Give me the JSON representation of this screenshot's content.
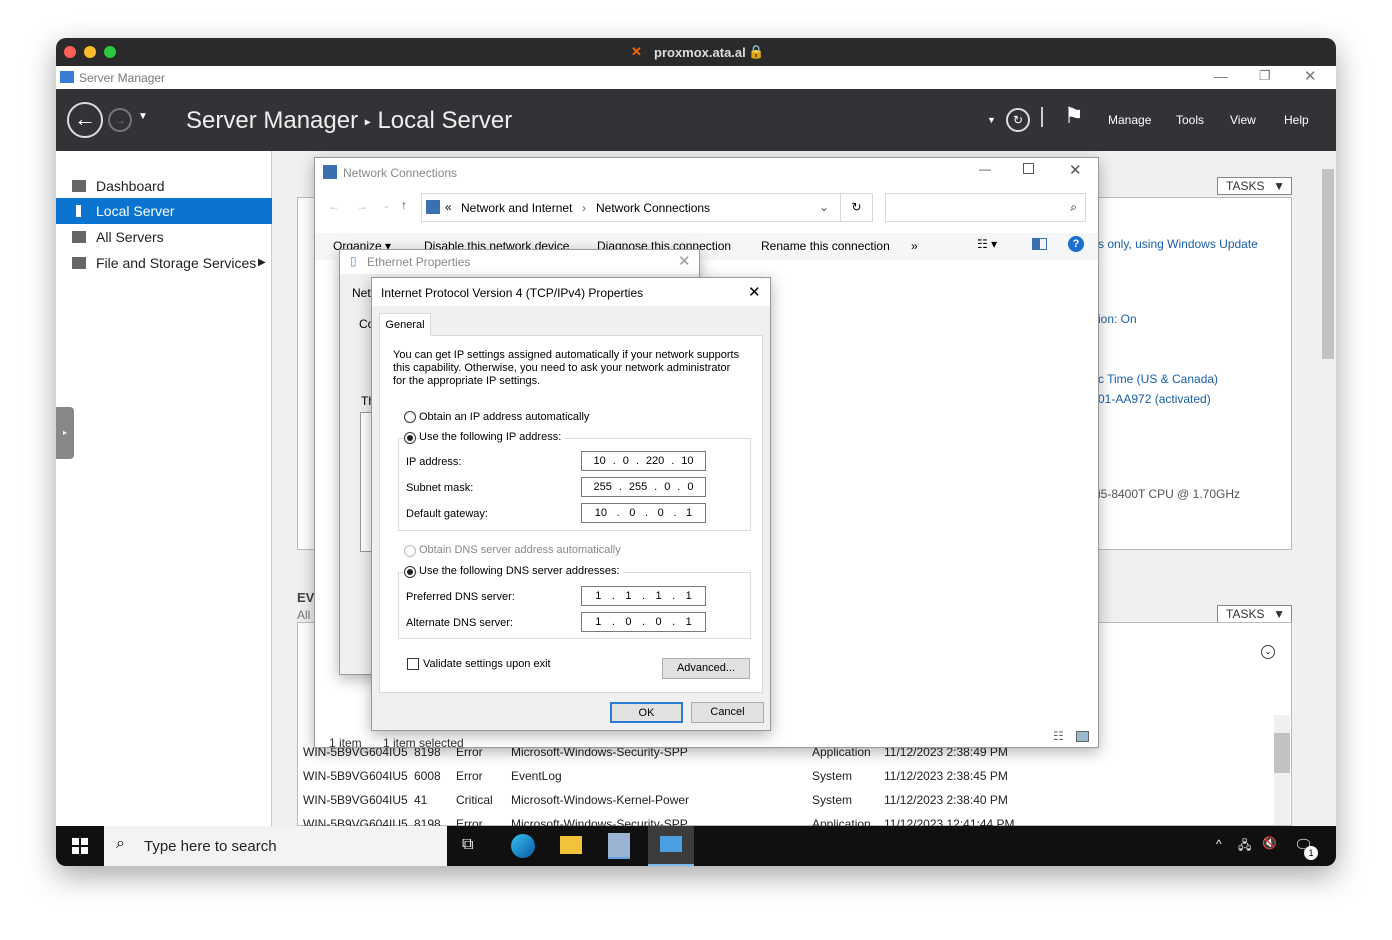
{
  "browser": {
    "url": "proxmox.ata.al"
  },
  "app": {
    "title": "Server Manager",
    "breadcrumb_root": "Server Manager",
    "breadcrumb_current": "Local Server",
    "menu": [
      "Manage",
      "Tools",
      "View",
      "Help"
    ]
  },
  "sidebar": {
    "items": [
      {
        "label": "Dashboard"
      },
      {
        "label": "Local Server",
        "selected": true
      },
      {
        "label": "All Servers"
      },
      {
        "label": "File and Storage Services"
      }
    ]
  },
  "main": {
    "tasks_label": "TASKS",
    "fragments": [
      "s only, using Windows Update",
      "ion: On",
      "c Time (US & Canada)",
      "01-AA972 (activated)",
      "i5-8400T CPU @ 1.70GHz"
    ],
    "events_title": "EV",
    "events_sub": "All",
    "events": [
      [
        "WIN-5B9VG604IU5",
        "8198",
        "Error",
        "Microsoft-Windows-Security-SPP",
        "Application",
        "11/12/2023 2:38:49 PM"
      ],
      [
        "WIN-5B9VG604IU5",
        "6008",
        "Error",
        "EventLog",
        "System",
        "11/12/2023 2:38:45 PM"
      ],
      [
        "WIN-5B9VG604IU5",
        "41",
        "Critical",
        "Microsoft-Windows-Kernel-Power",
        "System",
        "11/12/2023 2:38:40 PM"
      ],
      [
        "WIN-5B9VG604IU5",
        "8198",
        "Error",
        "Microsoft-Windows-Security-SPP",
        "Application",
        "11/12/2023 12:41:44 PM"
      ]
    ]
  },
  "netconn": {
    "title": "Network Connections",
    "path": [
      "Network and Internet",
      "Network Connections"
    ],
    "toolbar": [
      "Organize ▾",
      "Disable this network device",
      "Diagnose this connection",
      "Rename this connection",
      "»"
    ],
    "status_items": "1 item",
    "status_selected": "1 item selected"
  },
  "ethernet": {
    "title": "Ethernet Properties",
    "frag1": "Netv",
    "frag2": "Co",
    "frag3": "Th"
  },
  "ipv4": {
    "title": "Internet Protocol Version 4 (TCP/IPv4) Properties",
    "tab": "General",
    "description": "You can get IP settings assigned automatically if your network supports this capability. Otherwise, you need to ask your network administrator for the appropriate IP settings.",
    "obtain_ip": "Obtain an IP address automatically",
    "use_ip": "Use the following IP address:",
    "ip_label": "IP address:",
    "ip": [
      "10",
      "0",
      "220",
      "10"
    ],
    "mask_label": "Subnet mask:",
    "mask": [
      "255",
      "255",
      "0",
      "0"
    ],
    "gw_label": "Default gateway:",
    "gw": [
      "10",
      "0",
      "0",
      "1"
    ],
    "obtain_dns": "Obtain DNS server address automatically",
    "use_dns": "Use the following DNS server addresses:",
    "pdns_label": "Preferred DNS server:",
    "pdns": [
      "1",
      "1",
      "1",
      "1"
    ],
    "adns_label": "Alternate DNS server:",
    "adns": [
      "1",
      "0",
      "0",
      "1"
    ],
    "validate": "Validate settings upon exit",
    "advanced": "Advanced...",
    "ok": "OK",
    "cancel": "Cancel"
  },
  "taskbar": {
    "search_placeholder": "Type here to search",
    "notification_count": "1"
  }
}
